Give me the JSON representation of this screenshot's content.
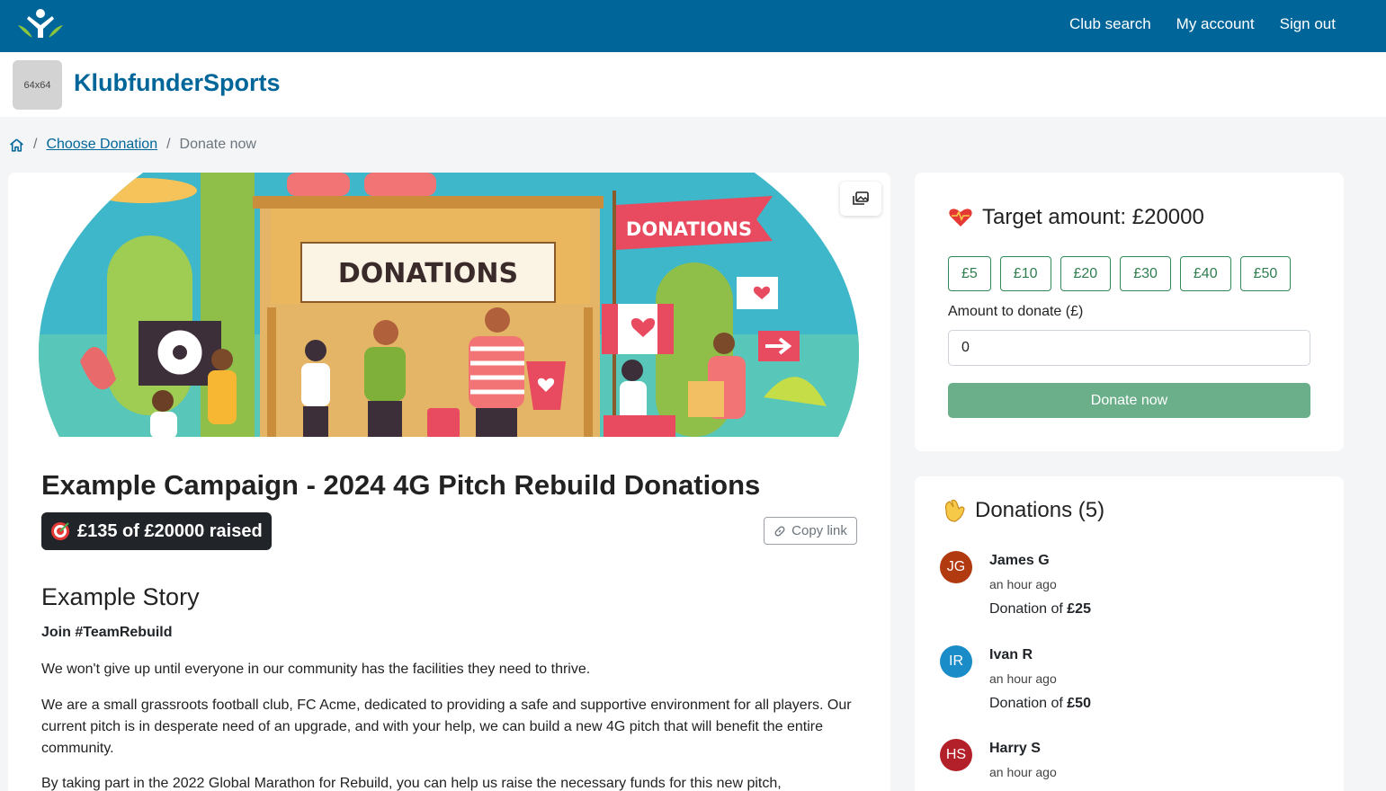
{
  "nav": {
    "club_search": "Club search",
    "my_account": "My account",
    "sign_out": "Sign out"
  },
  "org": {
    "image_placeholder": "64x64",
    "name": "KlubfunderSports"
  },
  "breadcrumb": {
    "choose": "Choose Donation",
    "current": "Donate now",
    "separator": "/"
  },
  "banner": {
    "sign_text": "DONATIONS",
    "flag_text": "DONATIONS"
  },
  "campaign": {
    "title": "Example Campaign - 2024 4G Pitch Rebuild Donations",
    "raised": "£135 of £20000 raised",
    "copy_link": "Copy link",
    "story_heading": "Example Story",
    "tagline": "Join #TeamRebuild",
    "paragraphs": [
      "We won't give up until everyone in our community has the facilities they need to thrive.",
      "We are a small grassroots football club, FC Acme, dedicated to providing a safe and supportive environment for all players. Our current pitch is in desperate need of an upgrade, and with your help, we can build a new 4G pitch that will benefit the entire community.",
      "By taking part in the 2022 Global Marathon for Rebuild, you can help us raise the necessary funds for this new pitch,"
    ]
  },
  "donate_panel": {
    "target": "Target amount: £20000",
    "amounts": [
      "£5",
      "£10",
      "£20",
      "£30",
      "£40",
      "£50"
    ],
    "amount_label": "Amount to donate (£)",
    "amount_value": "0",
    "button": "Donate now"
  },
  "donations": {
    "heading": "Donations (5)",
    "prefix": "Donation of ",
    "items": [
      {
        "initials": "JG",
        "name": "James G",
        "time": "an hour ago",
        "amount": "£25",
        "color": "#b23a10"
      },
      {
        "initials": "IR",
        "name": "Ivan R",
        "time": "an hour ago",
        "amount": "£50",
        "color": "#1a8cc8"
      },
      {
        "initials": "HS",
        "name": "Harry S",
        "time": "an hour ago",
        "amount": "",
        "color": "#b3202a"
      }
    ]
  }
}
